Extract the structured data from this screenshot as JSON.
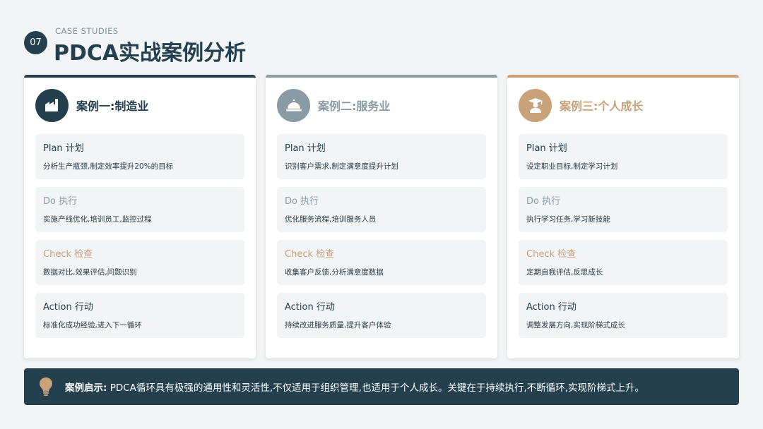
{
  "header": {
    "number": "07",
    "subtitle": "CASE STUDIES",
    "title": "PDCA实战案例分析"
  },
  "colors": {
    "navy": "#24404f",
    "slate": "#8a9ba6",
    "gold": "#c9a27a",
    "background": "#f2f4f6"
  },
  "cases": [
    {
      "title": "案例一:制造业",
      "icon": "factory-icon",
      "steps": [
        {
          "title": "Plan 计划",
          "desc": "分析生产瓶颈,制定效率提升20%的目标"
        },
        {
          "title": "Do 执行",
          "desc": "实施产线优化,培训员工,监控过程"
        },
        {
          "title": "Check 检查",
          "desc": "数据对比,效果评估,问题识别"
        },
        {
          "title": "Action 行动",
          "desc": "标准化成功经验,进入下一循环"
        }
      ]
    },
    {
      "title": "案例二:服务业",
      "icon": "service-bell-icon",
      "steps": [
        {
          "title": "Plan 计划",
          "desc": "识别客户需求,制定满意度提升计划"
        },
        {
          "title": "Do 执行",
          "desc": "优化服务流程,培训服务人员"
        },
        {
          "title": "Check 检查",
          "desc": "收集客户反馈,分析满意度数据"
        },
        {
          "title": "Action 行动",
          "desc": "持续改进服务质量,提升客户体验"
        }
      ]
    },
    {
      "title": "案例三:个人成长",
      "icon": "graduate-icon",
      "steps": [
        {
          "title": "Plan 计划",
          "desc": "设定职业目标,制定学习计划"
        },
        {
          "title": "Do 执行",
          "desc": "执行学习任务,学习新技能"
        },
        {
          "title": "Check 检查",
          "desc": "定期自我评估,反思成长"
        },
        {
          "title": "Action 行动",
          "desc": "调整发展方向,实现阶梯式成长"
        }
      ]
    }
  ],
  "footer": {
    "icon": "lightbulb-icon",
    "label": "案例启示:",
    "text": " PDCA循环具有极强的通用性和灵活性,不仅适用于组织管理,也适用于个人成长。关键在于持续执行,不断循环,实现阶梯式上升。"
  }
}
